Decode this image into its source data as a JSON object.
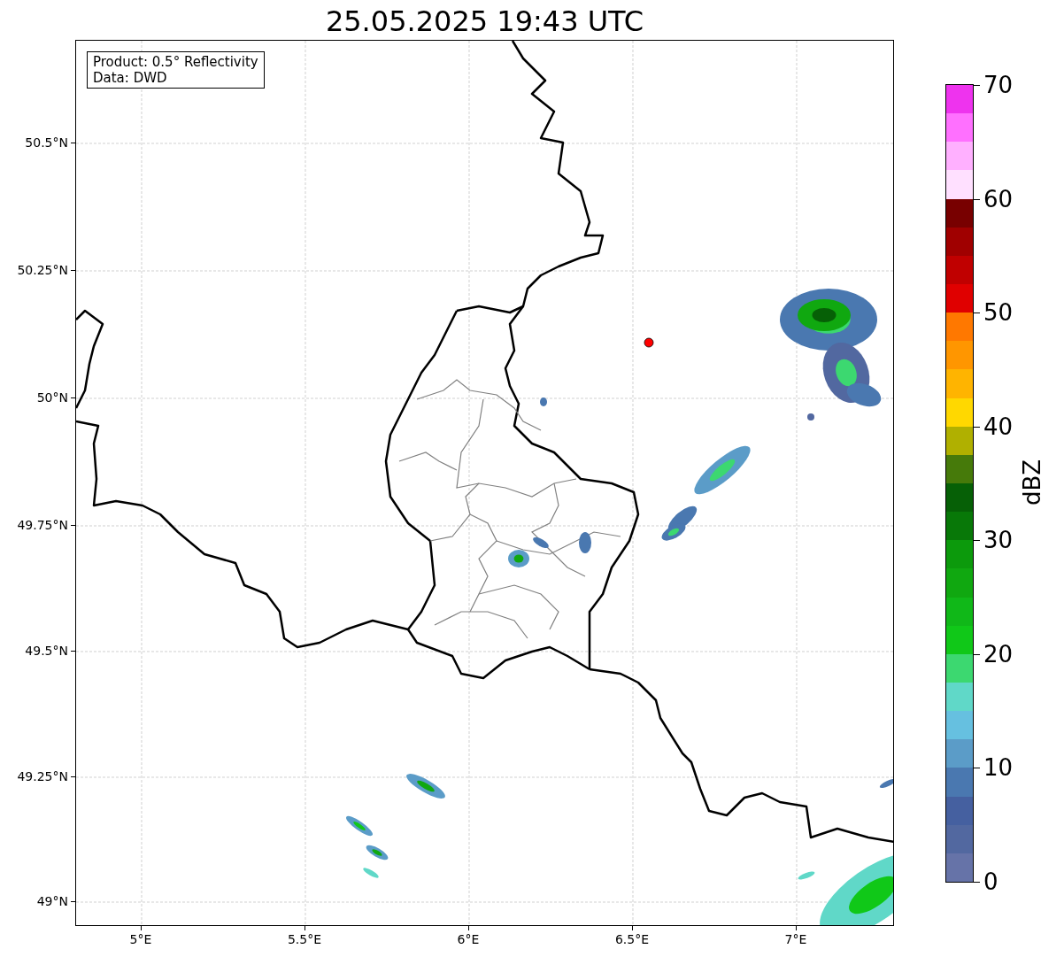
{
  "title": "25.05.2025 19:43 UTC",
  "map": {
    "info_lines": [
      "Product: 0.5° Reflectivity",
      "Data: DWD"
    ],
    "x_ticks": [
      "5°E",
      "5.5°E",
      "6°E",
      "6.5°E",
      "7°E"
    ],
    "y_ticks": [
      "50.5°N",
      "50.25°N",
      "50°N",
      "49.75°N",
      "49.5°N",
      "49.25°N",
      "49°N"
    ]
  },
  "colorbar": {
    "label": "dBZ",
    "ticks": [
      "70",
      "60",
      "50",
      "40",
      "30",
      "20",
      "10",
      "0"
    ],
    "segments": [
      {
        "color": "#ee33ee"
      },
      {
        "color": "#ff70ff"
      },
      {
        "color": "#ffb0ff"
      },
      {
        "color": "#ffe0ff"
      },
      {
        "color": "#780000"
      },
      {
        "color": "#a00000"
      },
      {
        "color": "#c00000"
      },
      {
        "color": "#e00000"
      },
      {
        "color": "#ff7800"
      },
      {
        "color": "#ff9600"
      },
      {
        "color": "#ffb400"
      },
      {
        "color": "#ffd800"
      },
      {
        "color": "#b0b000"
      },
      {
        "color": "#467a0a"
      },
      {
        "color": "#066006"
      },
      {
        "color": "#087808"
      },
      {
        "color": "#0c9a0c"
      },
      {
        "color": "#10a810"
      },
      {
        "color": "#10b818"
      },
      {
        "color": "#10c818"
      },
      {
        "color": "#3cd870"
      },
      {
        "color": "#60d8c8"
      },
      {
        "color": "#66c0e0"
      },
      {
        "color": "#5b9cc8"
      },
      {
        "color": "#4a78b0"
      },
      {
        "color": "#4560a0"
      },
      {
        "color": "#5268a0"
      },
      {
        "color": "#6673a8"
      }
    ]
  }
}
